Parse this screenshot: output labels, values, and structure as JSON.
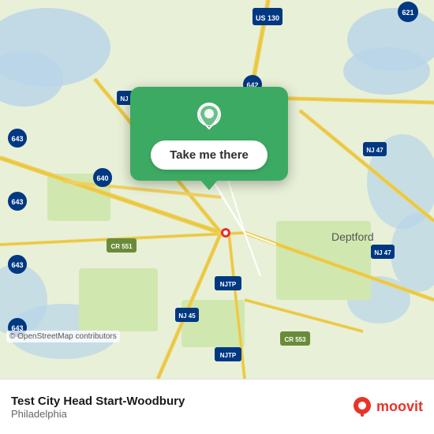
{
  "map": {
    "attribution": "© OpenStreetMap contributors",
    "background_color": "#e8f0d8"
  },
  "popup": {
    "button_label": "Take me there",
    "pin_color": "white"
  },
  "bottom_bar": {
    "location_name": "Test City Head Start-Woodbury",
    "location_city": "Philadelphia",
    "moovit_label": "moovit"
  }
}
